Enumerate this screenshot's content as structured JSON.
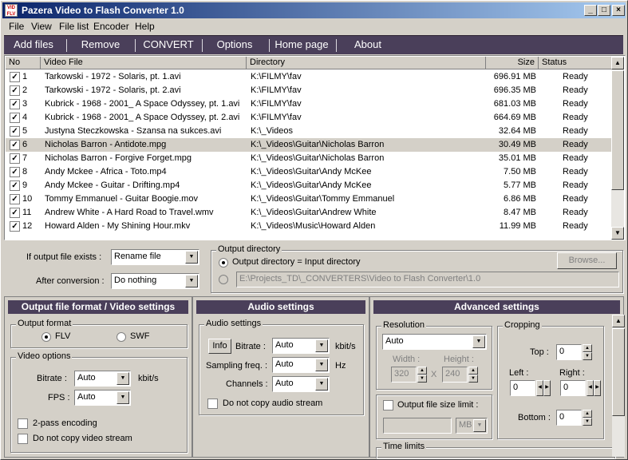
{
  "window": {
    "title": "Pazera Video to Flash Converter 1.0",
    "icon_text": "VID FLV"
  },
  "menu": [
    "File",
    "View",
    "File list",
    "Encoder",
    "Help"
  ],
  "toolbar": [
    "Add files",
    "Remove",
    "CONVERT",
    "Options",
    "Home page",
    "About"
  ],
  "file_list": {
    "columns": [
      "No",
      "Video File",
      "Directory",
      "Size",
      "Status"
    ],
    "rows": [
      {
        "no": "1",
        "file": "Tarkowski - 1972 - Solaris, pt. 1.avi",
        "dir": "K:\\FILMY\\fav",
        "size": "696.91 MB",
        "status": "Ready"
      },
      {
        "no": "2",
        "file": "Tarkowski - 1972 - Solaris, pt. 2.avi",
        "dir": "K:\\FILMY\\fav",
        "size": "696.35 MB",
        "status": "Ready"
      },
      {
        "no": "3",
        "file": "Kubrick - 1968 - 2001_ A Space Odyssey, pt. 1.avi",
        "dir": "K:\\FILMY\\fav",
        "size": "681.03 MB",
        "status": "Ready"
      },
      {
        "no": "4",
        "file": "Kubrick - 1968 - 2001_ A Space Odyssey, pt. 2.avi",
        "dir": "K:\\FILMY\\fav",
        "size": "664.69 MB",
        "status": "Ready"
      },
      {
        "no": "5",
        "file": "Justyna Steczkowska - Szansa na sukces.avi",
        "dir": "K:\\_Videos",
        "size": "32.64 MB",
        "status": "Ready"
      },
      {
        "no": "6",
        "file": "Nicholas Barron - Antidote.mpg",
        "dir": "K:\\_Videos\\Guitar\\Nicholas Barron",
        "size": "30.49 MB",
        "status": "Ready"
      },
      {
        "no": "7",
        "file": "Nicholas Barron - Forgive Forget.mpg",
        "dir": "K:\\_Videos\\Guitar\\Nicholas Barron",
        "size": "35.01 MB",
        "status": "Ready"
      },
      {
        "no": "8",
        "file": "Andy Mckee - Africa - Toto.mp4",
        "dir": "K:\\_Videos\\Guitar\\Andy McKee",
        "size": "7.50 MB",
        "status": "Ready"
      },
      {
        "no": "9",
        "file": "Andy Mckee - Guitar - Drifting.mp4",
        "dir": "K:\\_Videos\\Guitar\\Andy McKee",
        "size": "5.77 MB",
        "status": "Ready"
      },
      {
        "no": "10",
        "file": "Tommy Emmanuel - Guitar Boogie.mov",
        "dir": "K:\\_Videos\\Guitar\\Tommy Emmanuel",
        "size": "6.86 MB",
        "status": "Ready"
      },
      {
        "no": "11",
        "file": "Andrew White - A Hard Road to Travel.wmv",
        "dir": "K:\\_Videos\\Guitar\\Andrew White",
        "size": "8.47 MB",
        "status": "Ready"
      },
      {
        "no": "12",
        "file": "Howard Alden - My Shining Hour.mkv",
        "dir": "K:\\_Videos\\Music\\Howard Alden",
        "size": "11.99 MB",
        "status": "Ready"
      }
    ]
  },
  "output": {
    "exists_label": "If output file exists :",
    "exists_value": "Rename file",
    "after_label": "After conversion :",
    "after_value": "Do nothing",
    "dir_group": "Output directory",
    "dir_same_label": "Output directory = Input directory",
    "dir_path": "E:\\Projects_TD\\_CONVERTERS\\Video to Flash Converter\\1.0",
    "browse": "Browse..."
  },
  "video_panel": {
    "header": "Output file format / Video settings",
    "format_group": "Output format",
    "flv": "FLV",
    "swf": "SWF",
    "options_group": "Video options",
    "bitrate_label": "Bitrate :",
    "bitrate_value": "Auto",
    "bitrate_unit": "kbit/s",
    "fps_label": "FPS :",
    "fps_value": "Auto",
    "twopass": "2-pass encoding",
    "nocopy": "Do not copy video stream"
  },
  "audio_panel": {
    "header": "Audio settings",
    "group": "Audio settings",
    "info": "Info",
    "bitrate_label": "Bitrate :",
    "bitrate_value": "Auto",
    "bitrate_unit": "kbit/s",
    "freq_label": "Sampling freq. :",
    "freq_value": "Auto",
    "freq_unit": "Hz",
    "channels_label": "Channels :",
    "channels_value": "Auto",
    "nocopy": "Do not copy audio stream"
  },
  "advanced_panel": {
    "header": "Advanced settings",
    "res_group": "Resolution",
    "res_value": "Auto",
    "width_label": "Width :",
    "width_value": "320",
    "height_label": "Height :",
    "height_value": "240",
    "x": "X",
    "limit_label": "Output file size limit :",
    "limit_unit": "MB",
    "time_group": "Time limits",
    "crop_group": "Cropping",
    "top_label": "Top :",
    "top_value": "0",
    "left_label": "Left :",
    "left_value": "0",
    "right_label": "Right :",
    "right_value": "0",
    "bottom_label": "Bottom :",
    "bottom_value": "0"
  }
}
